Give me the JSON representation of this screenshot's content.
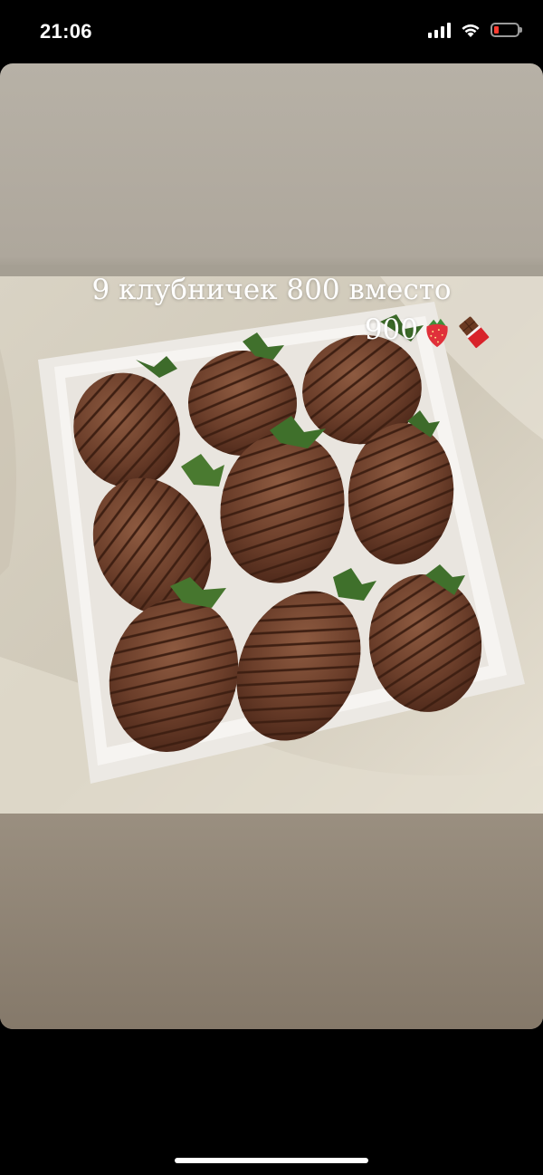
{
  "status_bar": {
    "time": "21:06",
    "icons": [
      "signal-icon",
      "wifi-icon",
      "battery-icon"
    ],
    "battery_color": "#ff3b30"
  },
  "story": {
    "caption_line1": "9  клубничек 800 вместо",
    "caption_line2": "900",
    "caption_emojis": [
      "strawberry-emoji",
      "chocolate-emoji"
    ]
  },
  "colors": {
    "background": "#000000",
    "card_top": "#b7b1a6",
    "card_bottom": "#85796a"
  }
}
